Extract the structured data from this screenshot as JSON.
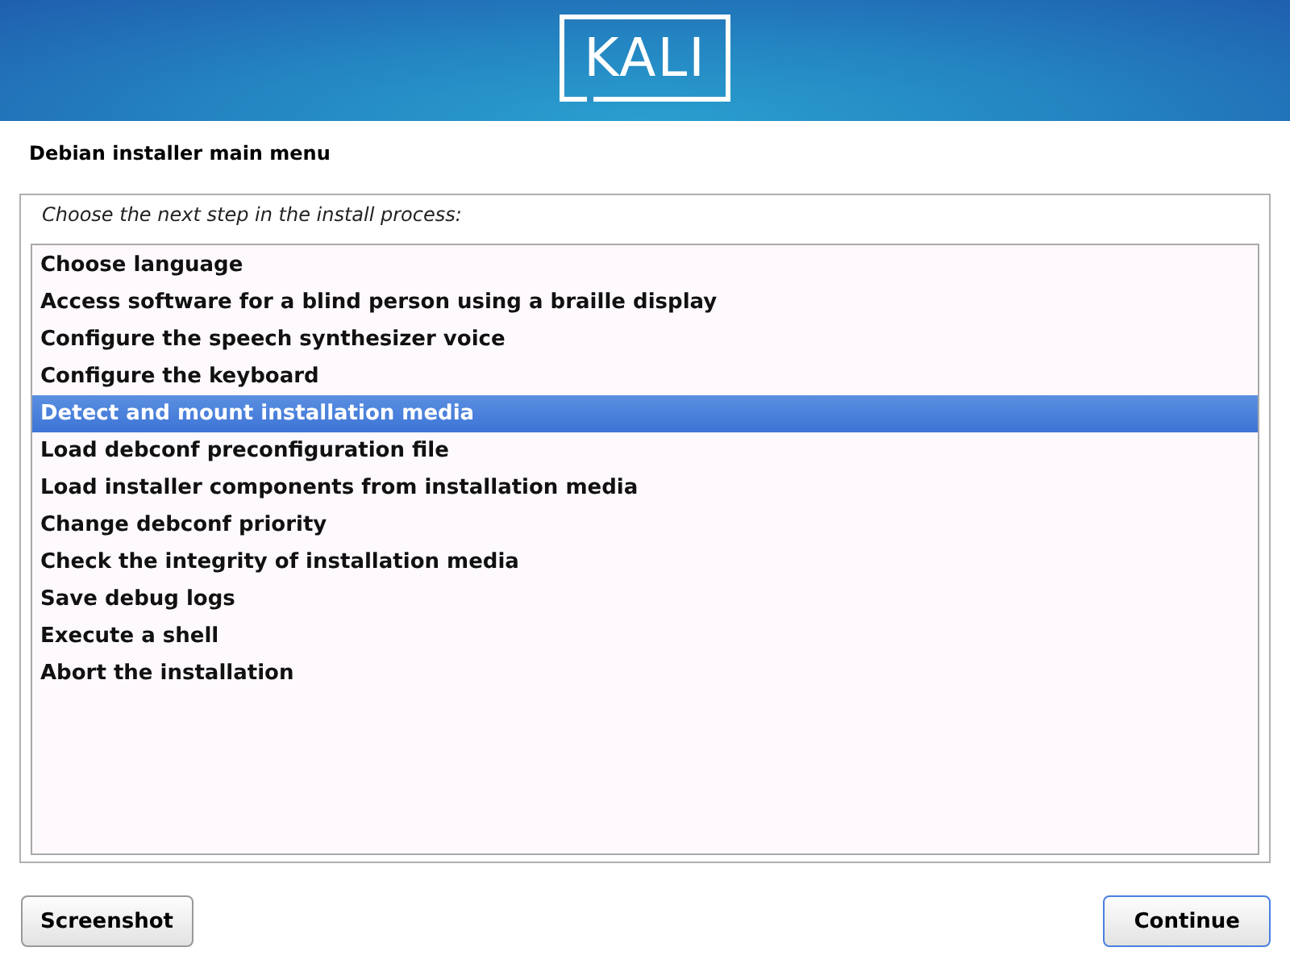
{
  "header": {
    "logo": "KALI"
  },
  "title": "Debian installer main menu",
  "prompt": "Choose the next step in the install process:",
  "items": [
    {
      "label": "Choose language",
      "selected": false
    },
    {
      "label": "Access software for a blind person using a braille display",
      "selected": false
    },
    {
      "label": "Configure the speech synthesizer voice",
      "selected": false
    },
    {
      "label": "Configure the keyboard",
      "selected": false
    },
    {
      "label": "Detect and mount installation media",
      "selected": true
    },
    {
      "label": "Load debconf preconfiguration file",
      "selected": false
    },
    {
      "label": "Load installer components from installation media",
      "selected": false
    },
    {
      "label": "Change debconf priority",
      "selected": false
    },
    {
      "label": "Check the integrity of installation media",
      "selected": false
    },
    {
      "label": "Save debug logs",
      "selected": false
    },
    {
      "label": "Execute a shell",
      "selected": false
    },
    {
      "label": "Abort the installation",
      "selected": false
    }
  ],
  "buttons": [
    {
      "label": "Screenshot",
      "focused": false
    },
    {
      "label": "Continue",
      "focused": true
    }
  ]
}
